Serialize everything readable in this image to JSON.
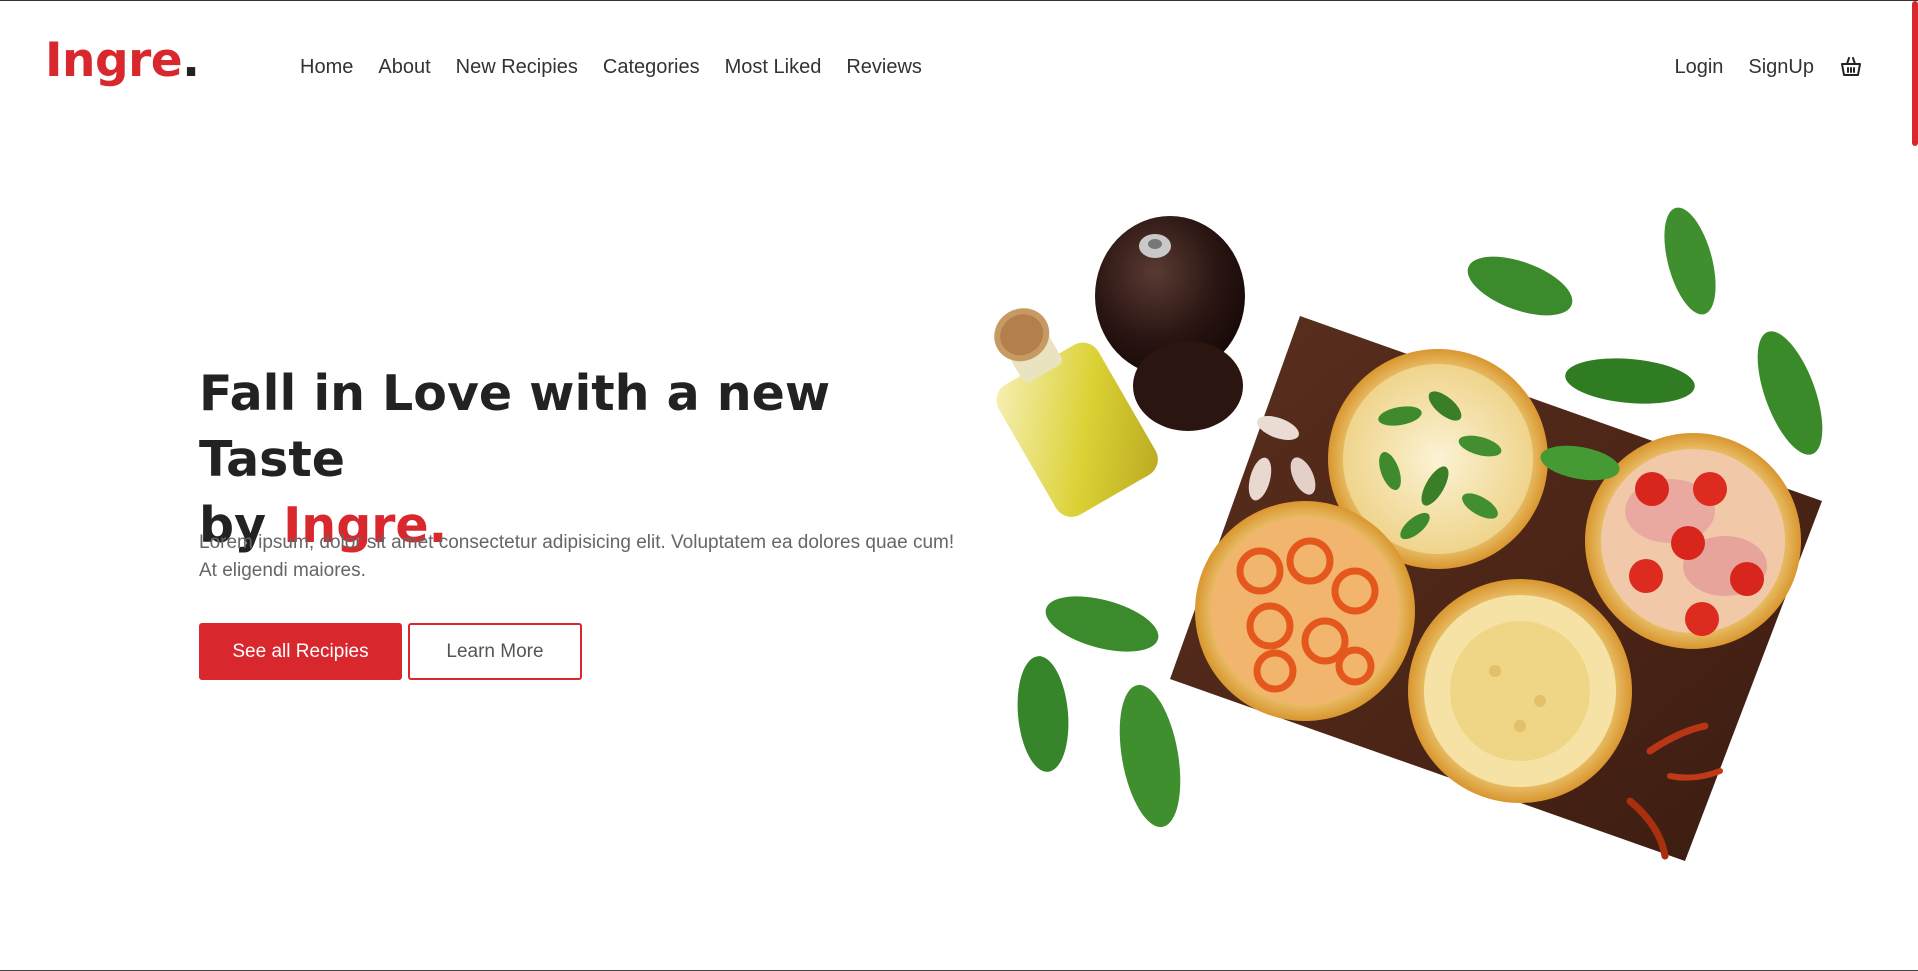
{
  "header": {
    "logo_text": "Ingre",
    "logo_dot": ".",
    "nav": [
      {
        "label": "Home"
      },
      {
        "label": "About"
      },
      {
        "label": "New Recipies"
      },
      {
        "label": "Categories"
      },
      {
        "label": "Most Liked"
      },
      {
        "label": "Reviews"
      }
    ],
    "login_label": "Login",
    "signup_label": "SignUp",
    "cart_icon": "basket-icon"
  },
  "hero": {
    "title_line1": "Fall in Love with a new Taste",
    "title_by": "by ",
    "title_brand": "Ingre.",
    "description": "Lorem ipsum, dolor sit amet consectetur adipisicing elit. Voluptatem ea dolores quae cum! At eligendi maiores.",
    "primary_button": "See all Recipies",
    "secondary_button": "Learn More"
  },
  "colors": {
    "accent": "#d9272e",
    "text_dark": "#222222",
    "text_muted": "#666666"
  }
}
